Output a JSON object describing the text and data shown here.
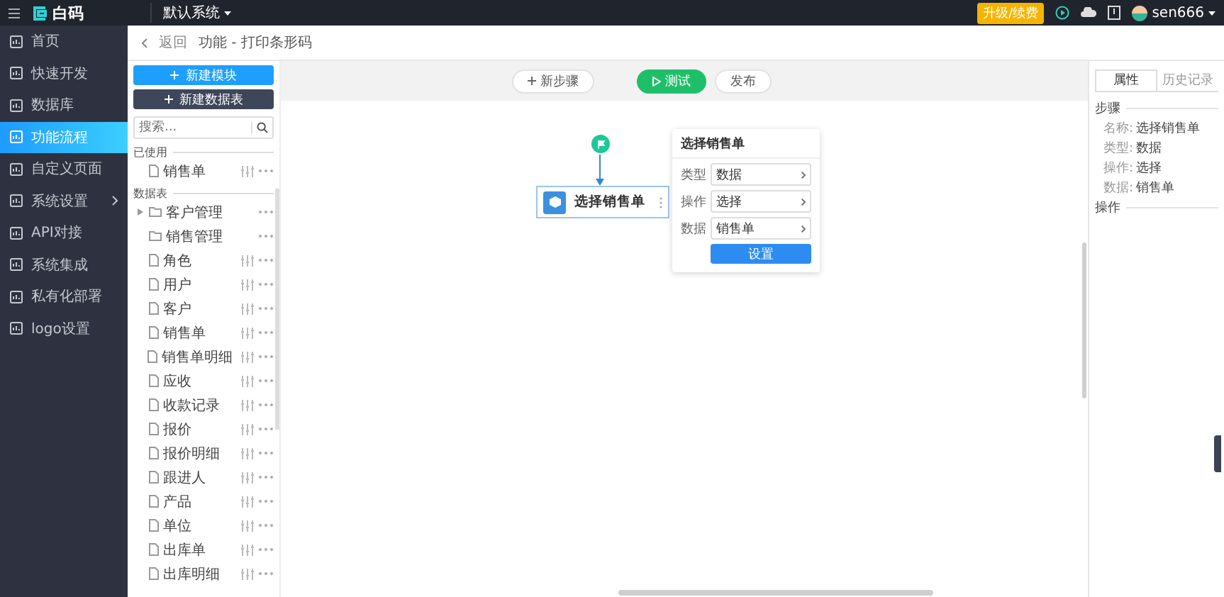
{
  "topbar": {
    "logo": "白码",
    "system": "默认系统",
    "upgrade": "升级/续费",
    "user": "sen666"
  },
  "sidebar": {
    "items": [
      {
        "label": "首页",
        "selected": false,
        "submenu": false
      },
      {
        "label": "快速开发",
        "selected": false,
        "submenu": false
      },
      {
        "label": "数据库",
        "selected": false,
        "submenu": false
      },
      {
        "label": "功能流程",
        "selected": true,
        "submenu": false
      },
      {
        "label": "自定义页面",
        "selected": false,
        "submenu": false
      },
      {
        "label": "系统设置",
        "selected": false,
        "submenu": true
      },
      {
        "label": "API对接",
        "selected": false,
        "submenu": false
      },
      {
        "label": "系统集成",
        "selected": false,
        "submenu": false
      },
      {
        "label": "私有化部署",
        "selected": false,
        "submenu": false
      },
      {
        "label": "logo设置",
        "selected": false,
        "submenu": false
      }
    ]
  },
  "breadcrumb": {
    "back": "返回",
    "title": "功能 - 打印条形码"
  },
  "left_panel": {
    "buttons": [
      {
        "label": "新建模块",
        "kind": "primary"
      },
      {
        "label": "新建数据表",
        "kind": "dark"
      }
    ],
    "search": {
      "placeholder": "搜索..."
    },
    "groups": [
      {
        "title": "已使用",
        "items": [
          {
            "label": "销售单",
            "kind": "table"
          }
        ]
      },
      {
        "title": "数据表",
        "items": [
          {
            "label": "客户管理",
            "kind": "folder",
            "collapsible": true
          },
          {
            "label": "销售管理",
            "kind": "folder",
            "collapsible": false
          },
          {
            "label": "角色",
            "kind": "table"
          },
          {
            "label": "用户",
            "kind": "table"
          },
          {
            "label": "客户",
            "kind": "table"
          },
          {
            "label": "销售单",
            "kind": "table"
          },
          {
            "label": "销售单明细",
            "kind": "table"
          },
          {
            "label": "应收",
            "kind": "table"
          },
          {
            "label": "收款记录",
            "kind": "table"
          },
          {
            "label": "报价",
            "kind": "table"
          },
          {
            "label": "报价明细",
            "kind": "table"
          },
          {
            "label": "跟进人",
            "kind": "table"
          },
          {
            "label": "产品",
            "kind": "table"
          },
          {
            "label": "单位",
            "kind": "table"
          },
          {
            "label": "出库单",
            "kind": "table"
          },
          {
            "label": "出库明细",
            "kind": "table"
          }
        ]
      }
    ]
  },
  "toolbar": {
    "buttons": [
      {
        "label": "新步骤",
        "kind": "add"
      },
      {
        "label": "测试",
        "kind": "run"
      },
      {
        "label": "发布",
        "kind": "plain"
      }
    ]
  },
  "canvas": {
    "node": {
      "label": "选择销售单"
    },
    "popup": {
      "title": "选择销售单",
      "fields": [
        {
          "label": "类型",
          "value": "数据"
        },
        {
          "label": "操作",
          "value": "选择"
        },
        {
          "label": "数据",
          "value": "销售单"
        }
      ],
      "button": "设置"
    }
  },
  "right_panel": {
    "tabs": [
      {
        "label": "属性",
        "selected": true
      },
      {
        "label": "历史记录",
        "selected": false
      }
    ],
    "sections": [
      {
        "title": "步骤",
        "rows": [
          {
            "label": "名称:",
            "value": "选择销售单"
          },
          {
            "label": "类型:",
            "value": "数据"
          },
          {
            "label": "操作:",
            "value": "选择"
          },
          {
            "label": "数据:",
            "value": "销售单"
          }
        ]
      },
      {
        "title": "操作"
      }
    ]
  }
}
